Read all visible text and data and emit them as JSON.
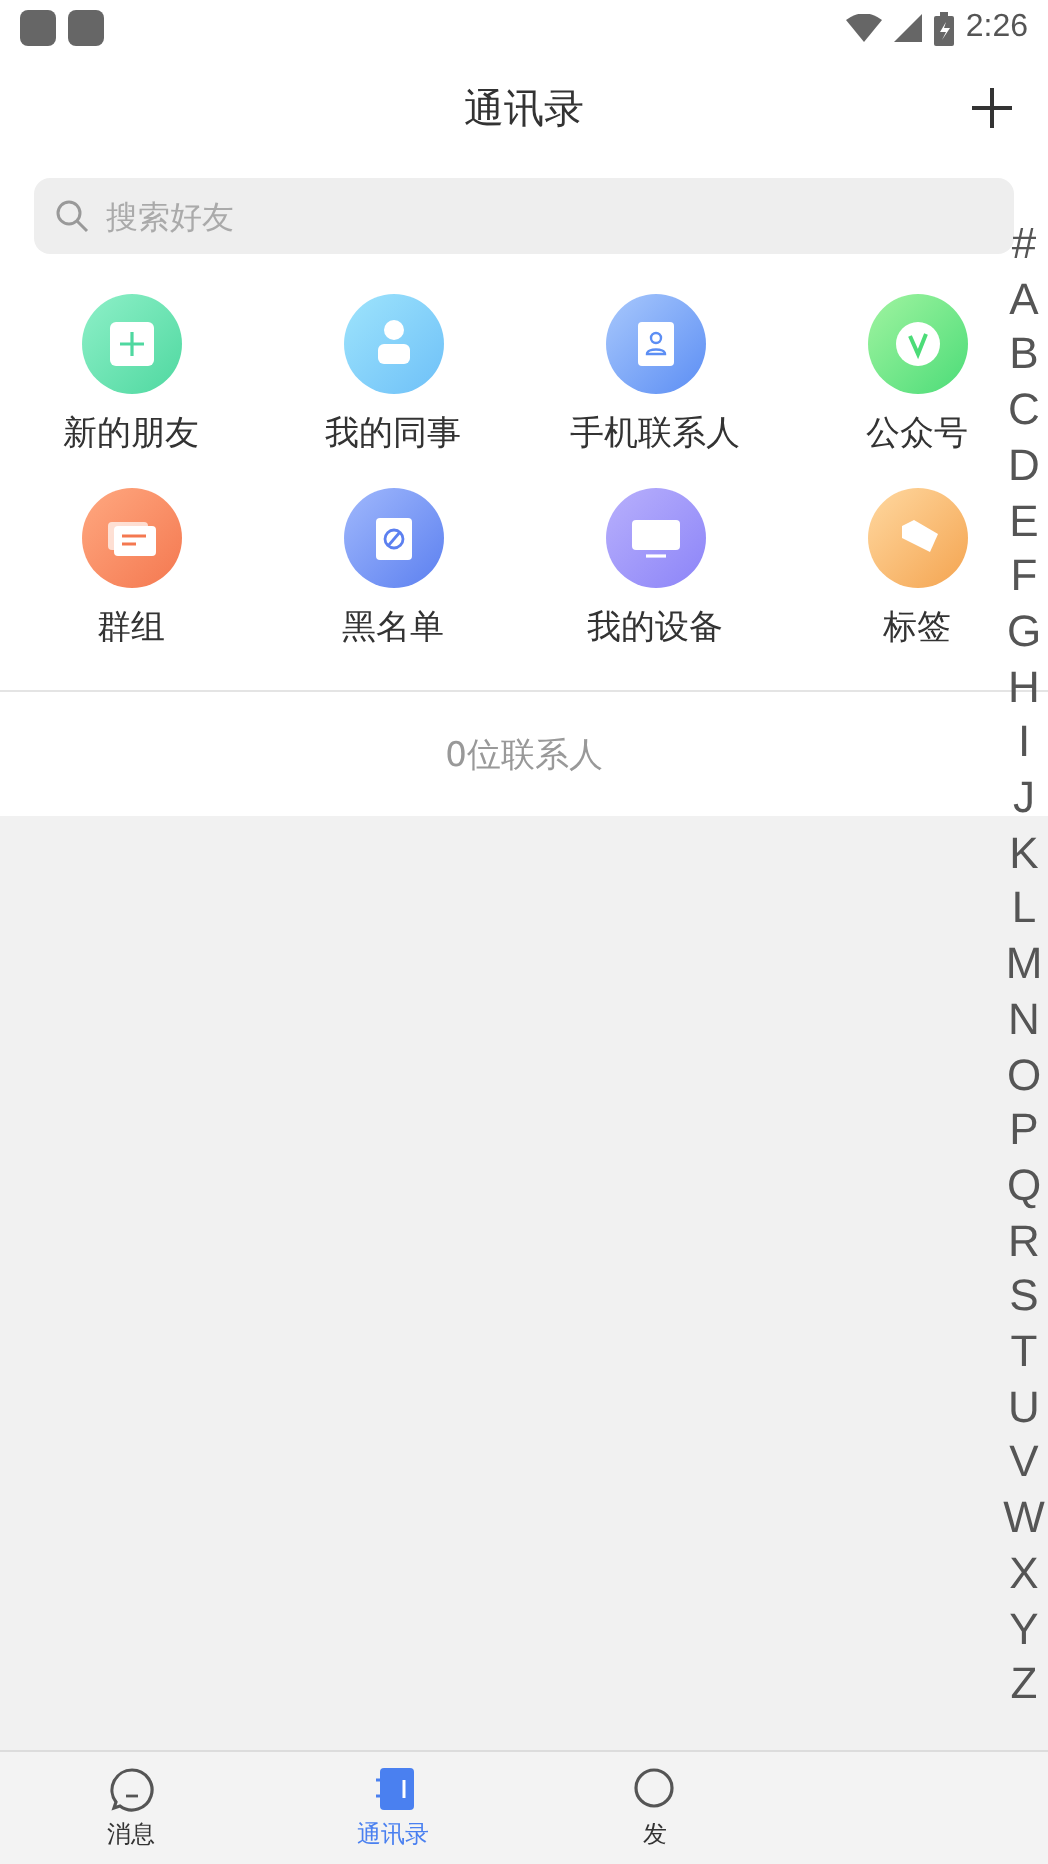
{
  "status_bar": {
    "time": "2:26"
  },
  "header": {
    "title": "通讯录"
  },
  "search": {
    "placeholder": "搜索好友"
  },
  "entries": [
    {
      "label": "新的朋友",
      "kind": "new-friend"
    },
    {
      "label": "我的同事",
      "kind": "colleague"
    },
    {
      "label": "手机联系人",
      "kind": "phone-contact"
    },
    {
      "label": "公众号",
      "kind": "official"
    },
    {
      "label": "群组",
      "kind": "group"
    },
    {
      "label": "黑名单",
      "kind": "blacklist"
    },
    {
      "label": "我的设备",
      "kind": "device"
    },
    {
      "label": "标签",
      "kind": "tag"
    }
  ],
  "contact_count": "0位联系人",
  "index_letters": [
    "#",
    "A",
    "B",
    "C",
    "D",
    "E",
    "F",
    "G",
    "H",
    "I",
    "J",
    "K",
    "L",
    "M",
    "N",
    "O",
    "P",
    "Q",
    "R",
    "S",
    "T",
    "U",
    "V",
    "W",
    "X",
    "Y",
    "Z"
  ],
  "tabs": [
    {
      "label": "消息",
      "kind": "chat",
      "selected": false
    },
    {
      "label": "通讯录",
      "kind": "contacts",
      "selected": true
    },
    {
      "label": "发",
      "kind": "discover",
      "selected": false
    }
  ]
}
